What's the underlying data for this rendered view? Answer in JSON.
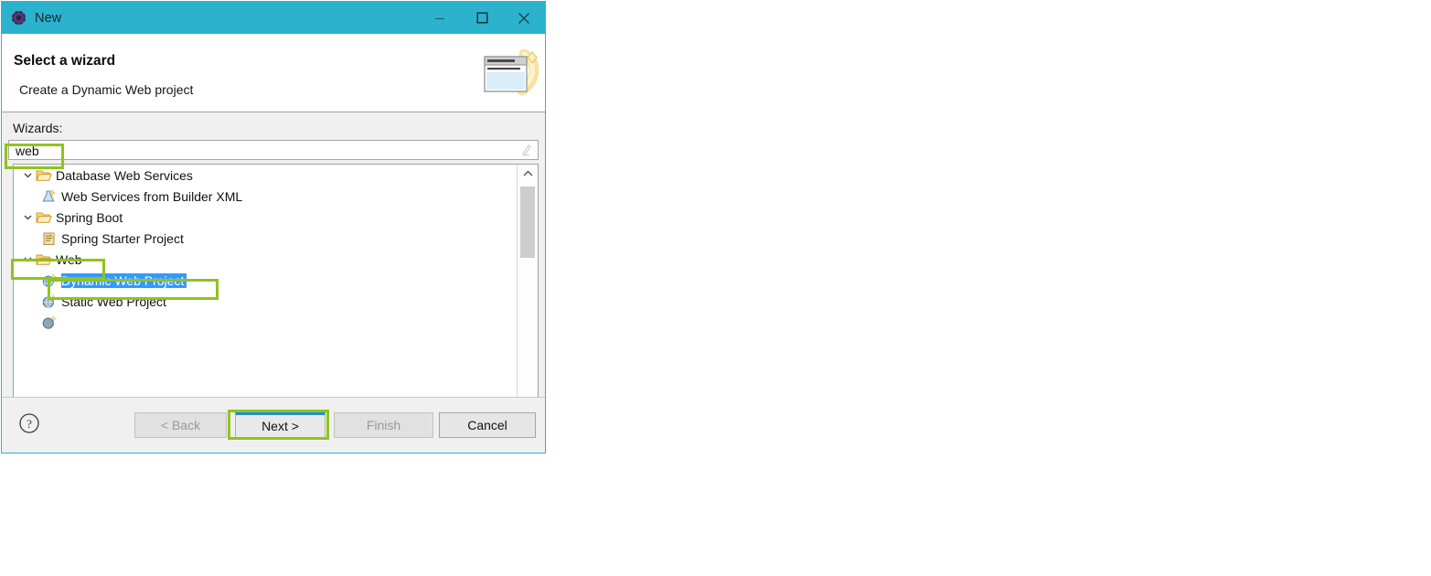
{
  "window": {
    "title": "New",
    "icon": "eclipse-icon",
    "controls": [
      {
        "name": "minimize-button",
        "glyph": "minimize-icon"
      },
      {
        "name": "maximize-button",
        "glyph": "maximize-icon"
      },
      {
        "name": "close-button",
        "glyph": "close-icon"
      }
    ]
  },
  "header": {
    "title": "Select a wizard",
    "subtitle": "Create a Dynamic Web project",
    "icon": "wizard-window-icon"
  },
  "body": {
    "wizards_label": "Wizards:",
    "search": {
      "value": "web",
      "placeholder": "",
      "clear_icon": "clear-pencil-icon"
    },
    "tree": [
      {
        "label": "Database Web Services",
        "level": 0,
        "icon": "folder-open-icon",
        "expanded": true,
        "selected": false
      },
      {
        "label": "Web Services from Builder XML",
        "level": 1,
        "icon": "builder-xml-icon",
        "expanded": null,
        "selected": false
      },
      {
        "label": "Spring Boot",
        "level": 0,
        "icon": "folder-open-icon",
        "expanded": true,
        "selected": false
      },
      {
        "label": "Spring Starter Project",
        "level": 1,
        "icon": "spring-project-icon",
        "expanded": null,
        "selected": false
      },
      {
        "label": "Web",
        "level": 0,
        "icon": "folder-open-icon",
        "expanded": true,
        "selected": false
      },
      {
        "label": "Dynamic Web Project",
        "level": 1,
        "icon": "dynamic-web-icon",
        "expanded": null,
        "selected": true
      },
      {
        "label": "Static Web Project",
        "level": 1,
        "icon": "static-web-icon",
        "expanded": null,
        "selected": false
      }
    ],
    "scrollbar": {
      "up_arrow": "chevron-up-icon",
      "down_arrow": "chevron-down-icon"
    }
  },
  "footer": {
    "help_icon": "help-question-icon",
    "buttons": {
      "back": {
        "label": "< Back",
        "enabled": false
      },
      "next": {
        "label": "Next >",
        "enabled": true,
        "default": true
      },
      "finish": {
        "label": "Finish",
        "enabled": false
      },
      "cancel": {
        "label": "Cancel",
        "enabled": true
      }
    }
  },
  "annotations": {
    "highlight_color": "#8FC31F",
    "boxes": [
      {
        "name": "annotation-search-field",
        "target": "web"
      },
      {
        "name": "annotation-web-category",
        "target": "Web"
      },
      {
        "name": "annotation-dynamic-web-project",
        "target": "Dynamic Web Project"
      },
      {
        "name": "annotation-next-button",
        "target": "Next >"
      }
    ]
  },
  "colors": {
    "titlebar": "#2BB3CD",
    "dialog_border": "#29B6D0",
    "body_background": "#F0F0F0",
    "selection": "#3399FF",
    "default_button_accent": "#1E90D2"
  }
}
